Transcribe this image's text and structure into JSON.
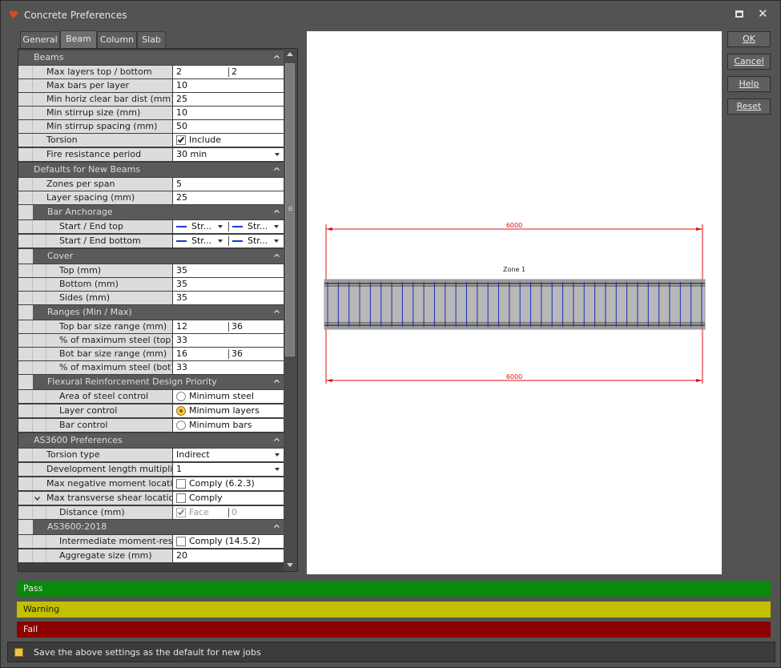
{
  "window": {
    "title": "Concrete Preferences"
  },
  "tabs": [
    "General",
    "Beam",
    "Column",
    "Slab"
  ],
  "active_tab": "Beam",
  "grid": {
    "rows": [
      {
        "kind": "section",
        "label": "Beams",
        "level": 0
      },
      {
        "kind": "text2",
        "label": "Max layers top / bottom",
        "level": 1,
        "v1": "2",
        "v2": "2"
      },
      {
        "kind": "text",
        "label": "Max bars per layer",
        "level": 1,
        "v": "10"
      },
      {
        "kind": "text",
        "label": "Min horiz clear bar dist (mm)",
        "level": 1,
        "v": "25"
      },
      {
        "kind": "text",
        "label": "Min stirrup size (mm)",
        "level": 1,
        "v": "10"
      },
      {
        "kind": "text",
        "label": "Min stirrup spacing (mm)",
        "level": 1,
        "v": "50"
      },
      {
        "kind": "check",
        "label": "Torsion",
        "level": 1,
        "v": "Include",
        "checked": true
      },
      {
        "kind": "select",
        "label": "Fire resistance period",
        "level": 1,
        "v": "30 min"
      },
      {
        "kind": "section",
        "label": "Defaults for New Beams",
        "level": 0
      },
      {
        "kind": "text",
        "label": "Zones per span",
        "level": 1,
        "v": "5"
      },
      {
        "kind": "text",
        "label": "Layer spacing (mm)",
        "level": 1,
        "v": "25"
      },
      {
        "kind": "section",
        "label": "Bar Anchorage",
        "level": 1
      },
      {
        "kind": "anchor",
        "label": "Start / End top",
        "level": 2,
        "v1": "Str...",
        "v2": "Str..."
      },
      {
        "kind": "anchor",
        "label": "Start / End bottom",
        "level": 2,
        "v1": "Str...",
        "v2": "Str..."
      },
      {
        "kind": "section",
        "label": "Cover",
        "level": 1
      },
      {
        "kind": "text",
        "label": "Top (mm)",
        "level": 2,
        "v": "35"
      },
      {
        "kind": "text",
        "label": "Bottom (mm)",
        "level": 2,
        "v": "35"
      },
      {
        "kind": "text",
        "label": "Sides (mm)",
        "level": 2,
        "v": "35"
      },
      {
        "kind": "section",
        "label": "Ranges (Min / Max)",
        "level": 1
      },
      {
        "kind": "text2",
        "label": "Top bar size range (mm)",
        "level": 2,
        "v1": "12",
        "v2": "36"
      },
      {
        "kind": "text",
        "label": "% of maximum steel (top)",
        "level": 2,
        "v": "33"
      },
      {
        "kind": "text2",
        "label": "Bot bar size range (mm)",
        "level": 2,
        "v1": "16",
        "v2": "36"
      },
      {
        "kind": "text",
        "label": "% of maximum steel (bot)",
        "level": 2,
        "v": "33"
      },
      {
        "kind": "section",
        "label": "Flexural Reinforcement Design Priority",
        "level": 1
      },
      {
        "kind": "radio",
        "label": "Area of steel control",
        "level": 2,
        "v": "Minimum steel",
        "selected": false
      },
      {
        "kind": "radio",
        "label": "Layer control",
        "level": 2,
        "v": "Minimum layers",
        "selected": true
      },
      {
        "kind": "radio",
        "label": "Bar control",
        "level": 2,
        "v": "Minimum bars",
        "selected": false
      },
      {
        "kind": "section",
        "label": "AS3600 Preferences",
        "level": 0
      },
      {
        "kind": "select",
        "label": "Torsion type",
        "level": 1,
        "v": "Indirect"
      },
      {
        "kind": "select",
        "label": "Development length multiplier",
        "level": 1,
        "v": "1"
      },
      {
        "kind": "check",
        "label": "Max negative moment location",
        "level": 1,
        "v": "Comply (6.2.3)",
        "checked": false
      },
      {
        "kind": "check",
        "label": "Max transverse shear location",
        "level": 1,
        "v": "Comply",
        "checked": false,
        "expanded": true
      },
      {
        "kind": "checkdis",
        "label": "Distance (mm)",
        "level": 2,
        "v": "Face",
        "v2": "0",
        "checked": true
      },
      {
        "kind": "section",
        "label": "AS3600:2018",
        "level": 1
      },
      {
        "kind": "check",
        "label": "Intermediate moment-resis...",
        "level": 2,
        "v": "Comply (14.5.2)",
        "checked": false
      },
      {
        "kind": "text",
        "label": "Aggregate size (mm)",
        "level": 2,
        "v": "20"
      }
    ]
  },
  "preview": {
    "dimension_top": "6000",
    "dimension_bottom": "6000",
    "zone_label": "Zone 1",
    "stirrup_count": 36,
    "colors": {
      "dimension": "#e01010",
      "stirrup": "#1a2fb8",
      "beam_fill": "#b8b8b8"
    }
  },
  "buttons": {
    "ok": "OK",
    "cancel": "Cancel",
    "help": "Help",
    "reset": "Reset"
  },
  "status": [
    {
      "label": "Pass",
      "color": "#0a8a0a"
    },
    {
      "label": "Warning",
      "color": "#c3c000"
    },
    {
      "label": "Fail",
      "color": "#8c0000"
    }
  ],
  "footer": {
    "text": "Save the above settings as the default for new jobs"
  }
}
